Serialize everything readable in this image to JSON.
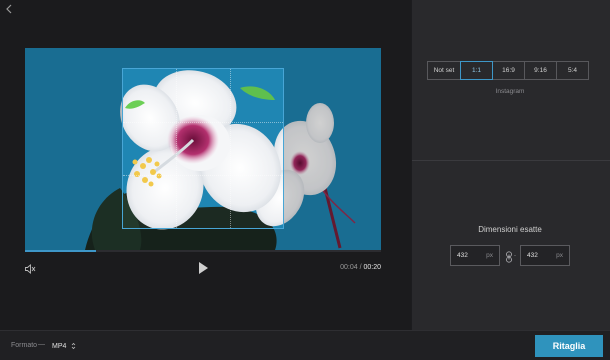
{
  "editor": {
    "playback": {
      "current_time": "00:04",
      "separator": " / ",
      "total_time": "00:20",
      "progress": 0.2
    }
  },
  "aspect_ratio": {
    "options": [
      {
        "label": "Not set",
        "active": false
      },
      {
        "label": "1:1",
        "active": true
      },
      {
        "label": "16:9",
        "active": false
      },
      {
        "label": "9:16",
        "active": false
      },
      {
        "label": "5:4",
        "active": false
      }
    ],
    "preset_label": "Instagram"
  },
  "dimensions": {
    "title": "Dimensioni esatte",
    "width": "432",
    "height": "432",
    "unit": "px",
    "separator": "-"
  },
  "footer": {
    "format_label": "Formato",
    "format_dash": "—",
    "format_value": "MP4",
    "crop_button": "Ritaglia"
  },
  "colors": {
    "accent": "#2f93bd",
    "panel_bg": "#29292c",
    "editor_bg": "#1b1b1d",
    "video_bg": "#1f86b3"
  },
  "icons": {
    "back": "chevron-left-icon",
    "mute": "speaker-muted-icon",
    "play": "play-icon",
    "link": "chain-link-icon",
    "format_caret": "up-down-caret-icon"
  }
}
